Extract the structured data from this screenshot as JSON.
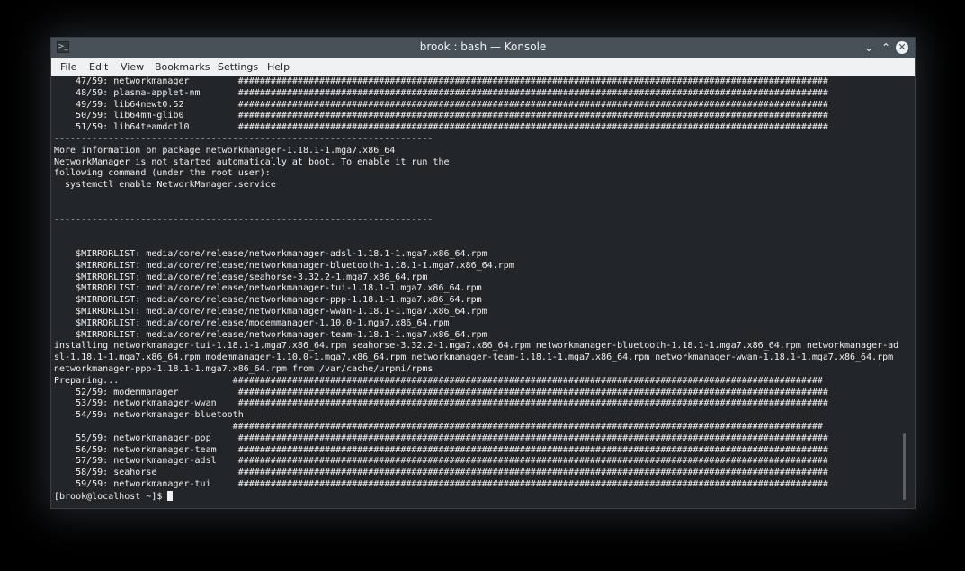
{
  "window": {
    "title": "brook : bash — Konsole"
  },
  "menu": [
    "File",
    "Edit",
    "View",
    "Bookmarks",
    "Settings",
    "Help"
  ],
  "terminal": {
    "lines": [
      "    47/59: networkmanager         #############################################################################################################",
      "    48/59: plasma-applet-nm       #############################################################################################################",
      "    49/59: lib64newt0.52          #############################################################################################################",
      "    50/59: lib64mm-glib0          #############################################################################################################",
      "    51/59: lib64teamdctl0         #############################################################################################################",
      "----------------------------------------------------------------------",
      "More information on package networkmanager-1.18.1-1.mga7.x86_64",
      "NetworkManager is not started automatically at boot. To enable it run the",
      "following command (under the root user):",
      "  systemctl enable NetworkManager.service",
      "",
      "",
      "----------------------------------------------------------------------",
      "",
      "",
      "    $MIRRORLIST: media/core/release/networkmanager-adsl-1.18.1-1.mga7.x86_64.rpm",
      "    $MIRRORLIST: media/core/release/networkmanager-bluetooth-1.18.1-1.mga7.x86_64.rpm",
      "    $MIRRORLIST: media/core/release/seahorse-3.32.2-1.mga7.x86_64.rpm",
      "    $MIRRORLIST: media/core/release/networkmanager-tui-1.18.1-1.mga7.x86_64.rpm",
      "    $MIRRORLIST: media/core/release/networkmanager-ppp-1.18.1-1.mga7.x86_64.rpm",
      "    $MIRRORLIST: media/core/release/networkmanager-wwan-1.18.1-1.mga7.x86_64.rpm",
      "    $MIRRORLIST: media/core/release/modemmanager-1.10.0-1.mga7.x86_64.rpm",
      "    $MIRRORLIST: media/core/release/networkmanager-team-1.18.1-1.mga7.x86_64.rpm",
      "installing networkmanager-tui-1.18.1-1.mga7.x86_64.rpm seahorse-3.32.2-1.mga7.x86_64.rpm networkmanager-bluetooth-1.18.1-1.mga7.x86_64.rpm networkmanager-ad",
      "sl-1.18.1-1.mga7.x86_64.rpm modemmanager-1.10.0-1.mga7.x86_64.rpm networkmanager-team-1.18.1-1.mga7.x86_64.rpm networkmanager-wwan-1.18.1-1.mga7.x86_64.rpm",
      "networkmanager-ppp-1.18.1-1.mga7.x86_64.rpm from /var/cache/urpmi/rpms",
      "Preparing...                     #############################################################################################################",
      "    52/59: modemmanager           #############################################################################################################",
      "    53/59: networkmanager-wwan    #############################################################################################################",
      "    54/59: networkmanager-bluetooth",
      "                                 #############################################################################################################",
      "    55/59: networkmanager-ppp     #############################################################################################################",
      "    56/59: networkmanager-team    #############################################################################################################",
      "    57/59: networkmanager-adsl    #############################################################################################################",
      "    58/59: seahorse               #############################################################################################################",
      "    59/59: networkmanager-tui     #############################################################################################################"
    ],
    "prompt": "[brook@localhost ~]$ "
  }
}
